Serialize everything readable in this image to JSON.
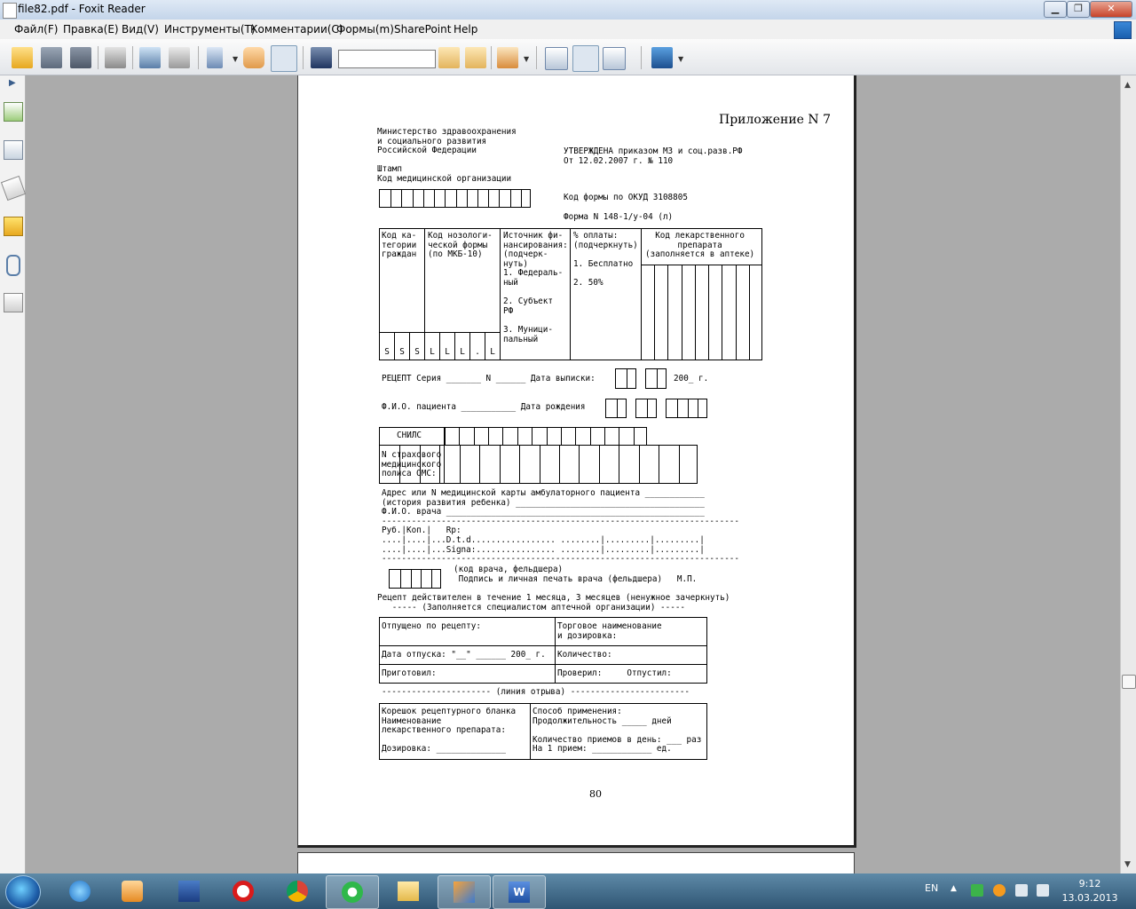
{
  "window": {
    "title": "file82.pdf - Foxit Reader"
  },
  "menu": [
    "Файл(F)",
    "Правка(E)",
    "Вид(V)",
    "Инструменты(T)",
    "Комментарии(C)",
    "Формы(m)",
    "SharePoint",
    "Help"
  ],
  "toolbar": {
    "search_value": ""
  },
  "document": {
    "appendix": "Приложение N 7",
    "ministry": "Министерство здравоохранения\nи социального развития\nРоссийской Федерации",
    "approved": "УТВЕРЖДЕНА приказом МЗ и соц.разв.РФ\nОт 12.02.2007 г. № 110",
    "stamp": "Штамп\nКод медицинской организации",
    "okud": "Код формы по ОКУД 3108805",
    "form_no": "Форма N 148-1/у-04 (л)",
    "col1": "Код ка-\nтегории\nграждан",
    "col2": "Код нозологи-\nческой формы\n(по МКБ-10)",
    "col3": "Источник фи-\nнансирования:\n(подчерк-\nнуть)\n1. Федераль-\nный\n\n2. Субъект\nРФ\n\n3. Муници-\nпальный",
    "col4": "% оплаты:\n(подчеркнуть)\n\n1. Бесплатно\n\n2. 50%",
    "col5": "Код лекарственного\nпрепарата\n(заполняется в аптеке)",
    "code_letters": [
      "S",
      "S",
      "S",
      "L",
      "L",
      "L",
      ".",
      "L"
    ],
    "recipe_line": "РЕЦЕПТ Серия _______ N ______ Дата выписки:",
    "year_label": "200_ г.",
    "patient_line": "Ф.И.О. пациента ___________ Дата рождения",
    "snils": "СНИЛС",
    "policy": "N страхового\nмедицинского\nполиса ОМС:",
    "address_block": "Адрес или N медицинской карты амбулаторного пациента ____________\n(история развития ребенка) ______________________________________\nФ.И.О. врача ____________________________________________________\n------------------------------------------------------------------------\nРуб.|Коп.|   Rp:\n....|....|...D.t.d................. ........|.........|.........|\n....|....|...Signa:................ ........|.........|.........|\n------------------------------------------------------------------------",
    "doctor_code": "(код врача, фельдшера)\n Подпись и личная печать врача (фельдшера)   М.П.",
    "validity": "Рецепт действителен в течение 1 месяца, 3 месяцев (ненужное зачеркнуть)\n   ----- (Заполняется специалистом аптечной организации) -----",
    "pharmacy": {
      "dispensed": "Отпущено по рецепту:",
      "trade_name": "Торговое наименование\nи дозировка:",
      "dispense_date": "Дата отпуска: \"__\" ______ 200_ г.",
      "quantity": "Количество:",
      "prepared": "Приготовил:",
      "checked": "Проверил:     Отпустил:"
    },
    "tear_line": "---------------------- (линия отрыва) ------------------------",
    "stub": {
      "left": "Корешок рецептурного бланка\nНаименование\nлекарственного препарата:\n\nДозировка: ______________",
      "right": "Способ применения:\nПродолжительность _____ дней\n\nКоличество приемов в день: ___ раз\nНа 1 прием: ____________ ед."
    },
    "page_number": "80"
  },
  "tray": {
    "lang": "EN",
    "time": "9:12",
    "date": "13.03.2013"
  }
}
